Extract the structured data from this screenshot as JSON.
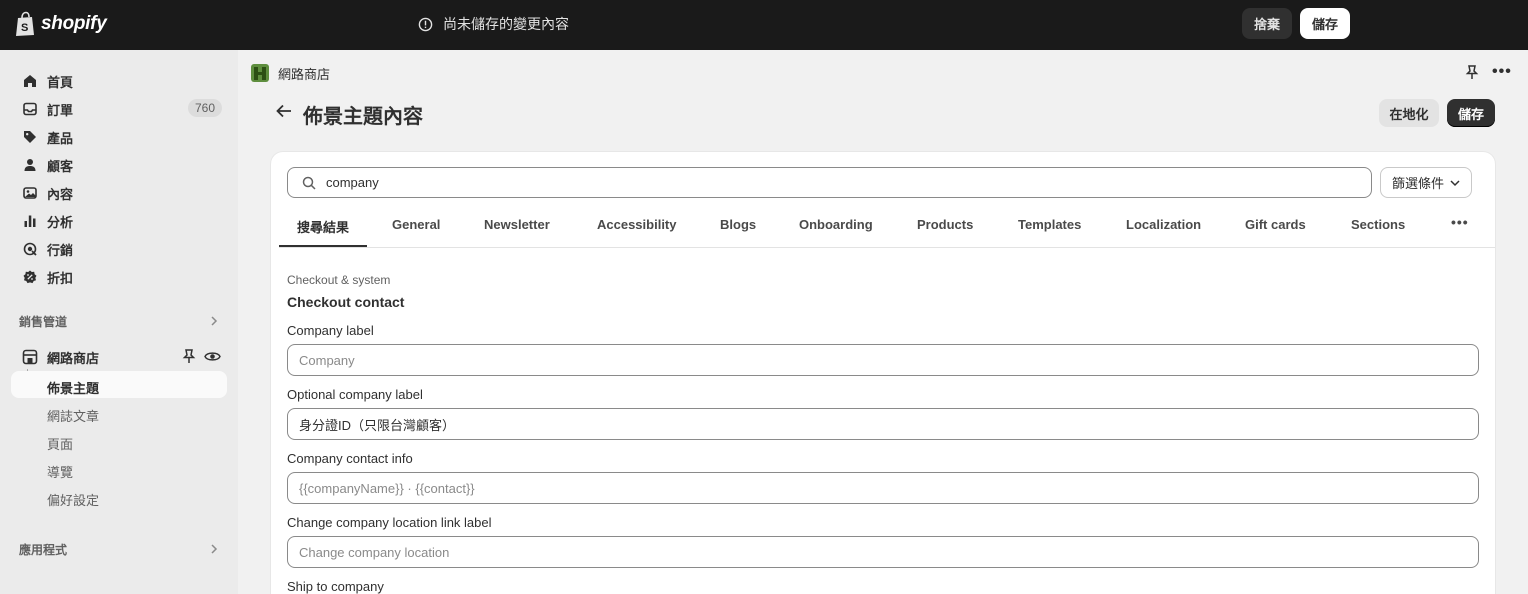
{
  "topbar": {
    "logo_text": "shopify",
    "unsaved_message": "尚未儲存的變更內容",
    "discard_label": "捨棄",
    "save_label": "儲存"
  },
  "sidebar": {
    "items": [
      {
        "label": "首頁",
        "icon": "home-icon"
      },
      {
        "label": "訂單",
        "icon": "inbox-icon",
        "badge": "760"
      },
      {
        "label": "產品",
        "icon": "tag-icon"
      },
      {
        "label": "顧客",
        "icon": "person-icon"
      },
      {
        "label": "內容",
        "icon": "image-icon"
      },
      {
        "label": "分析",
        "icon": "bar-chart-icon"
      },
      {
        "label": "行銷",
        "icon": "target-icon"
      },
      {
        "label": "折扣",
        "icon": "discount-icon"
      }
    ],
    "sales_channels_label": "銷售管道",
    "online_store_label": "網路商店",
    "sub_items": {
      "themes": "佈景主題",
      "blog_posts": "網誌文章",
      "pages": "頁面",
      "navigation": "導覽",
      "preferences": "偏好設定"
    },
    "apps_label": "應用程式"
  },
  "main": {
    "store_name": "網路商店",
    "page_title": "佈景主題內容",
    "localize_label": "在地化",
    "save_label": "儲存",
    "search": {
      "value": "company",
      "placeholder": ""
    },
    "filter_label": "篩選條件",
    "tabs": [
      {
        "label": "搜尋結果"
      },
      {
        "label": "General"
      },
      {
        "label": "Newsletter"
      },
      {
        "label": "Accessibility"
      },
      {
        "label": "Blogs"
      },
      {
        "label": "Onboarding"
      },
      {
        "label": "Products"
      },
      {
        "label": "Templates"
      },
      {
        "label": "Localization"
      },
      {
        "label": "Gift cards"
      },
      {
        "label": "Sections"
      }
    ],
    "more_tabs_icon": "ellipsis-icon",
    "breadcrumb": "Checkout & system",
    "section_title": "Checkout contact",
    "fields": [
      {
        "label": "Company label",
        "placeholder": "Company",
        "value": ""
      },
      {
        "label": "Optional company label",
        "placeholder": "",
        "value": "身分證ID（只限台灣顧客）"
      },
      {
        "label": "Company contact info",
        "placeholder": "{{companyName}} · {{contact}}",
        "value": ""
      },
      {
        "label": "Change company location link label",
        "placeholder": "Change company location",
        "value": ""
      },
      {
        "label": "Ship to company",
        "placeholder": "",
        "value": ""
      }
    ]
  },
  "colors": {
    "topbar_bg": "#1a1a1a",
    "sidebar_bg": "#ebebeb",
    "page_bg": "#f1f1f1",
    "primary_button": "#303030"
  }
}
